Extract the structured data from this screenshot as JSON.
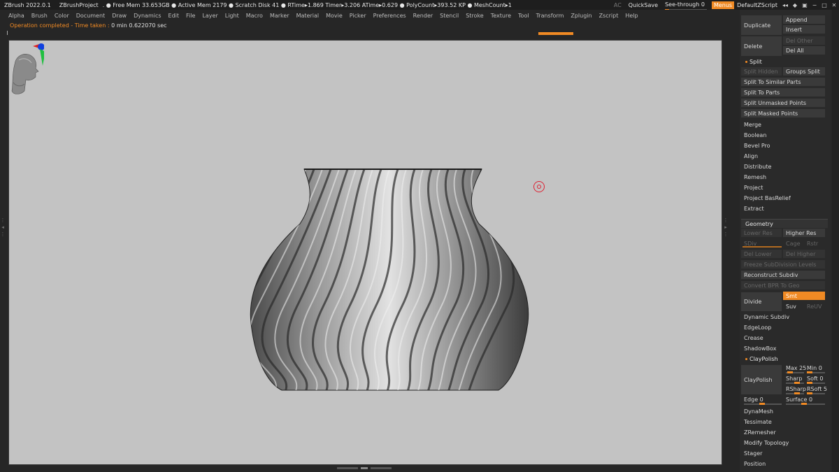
{
  "titlebar": {
    "app": "ZBrush 2022.0.1",
    "project": "ZBrushProject",
    "stats": ". ● Free Mem 33.653GB ● Active Mem 2179 ● Scratch Disk 41 ●  RTime▸1.869 Timer▸3.206 ATime▸0.629 ● PolyCount▸393.52 KP  ● MeshCount▸1",
    "ac": "AC",
    "quicksave": "QuickSave",
    "seethrough": "See-through  0",
    "menus": "Menus",
    "script": "DefaultZScript",
    "icons": [
      "◂◂",
      "◆",
      "▣",
      "−",
      "□",
      "✕"
    ]
  },
  "menubar": [
    "Alpha",
    "Brush",
    "Color",
    "Document",
    "Draw",
    "Dynamics",
    "Edit",
    "File",
    "Layer",
    "Light",
    "Macro",
    "Marker",
    "Material",
    "Movie",
    "Picker",
    "Preferences",
    "Render",
    "Stencil",
    "Stroke",
    "Texture",
    "Tool",
    "Transform",
    "Zplugin",
    "Zscript",
    "Help"
  ],
  "status": {
    "label": "Operation completed - Time taken : ",
    "value": "0 min 0.622070 sec"
  },
  "panel": {
    "duplicate": "Duplicate",
    "append": "Append",
    "insert": "Insert",
    "delete": "Delete",
    "del_other": "Del Other",
    "del_all": "Del All",
    "split_hdr": "Split",
    "split_hidden": "Split Hidden",
    "groups_split": "Groups Split",
    "split_similar": "Split To Similar Parts",
    "split_parts": "Split To Parts",
    "split_unmasked": "Split Unmasked Points",
    "split_masked": "Split Masked Points",
    "merge": "Merge",
    "boolean": "Boolean",
    "bevel_pro": "Bevel Pro",
    "align": "Align",
    "distribute": "Distribute",
    "remesh": "Remesh",
    "project": "Project",
    "project_basrelief": "Project BasRelief",
    "extract": "Extract",
    "geometry_hdr": "Geometry",
    "lower_res": "Lower Res",
    "higher_res": "Higher Res",
    "sdiv": "SDiv",
    "cage": "Cage",
    "rstr": "Rstr",
    "del_lower": "Del Lower",
    "del_higher": "Del Higher",
    "freeze_subdiv": "Freeze SubDivision Levels",
    "reconstruct_subdiv": "Reconstruct Subdiv",
    "convert_bpr": "Convert BPR To Geo",
    "divide": "Divide",
    "smt": "Smt",
    "suv": "Suv",
    "reuv": "ReUV",
    "dynamic_subdiv": "Dynamic Subdiv",
    "edgeloop": "EdgeLoop",
    "crease": "Crease",
    "shadowbox": "ShadowBox",
    "claypolish_hdr": "ClayPolish",
    "claypolish": "ClayPolish",
    "max": "Max 25",
    "min": "Min 0",
    "sharp": "Sharp",
    "soft": "Soft 0",
    "rsharp": "RSharp",
    "rsoft": "RSoft 5",
    "edge": "Edge 0",
    "surface": "Surface 0",
    "dynamesh": "DynaMesh",
    "tessimate": "Tessimate",
    "zremesher": "ZRemesher",
    "modify_topology": "Modify Topology",
    "stager": "Stager",
    "position": "Position"
  },
  "colors": {
    "accent": "#f08a24",
    "canvas": "#c3c3c3"
  }
}
